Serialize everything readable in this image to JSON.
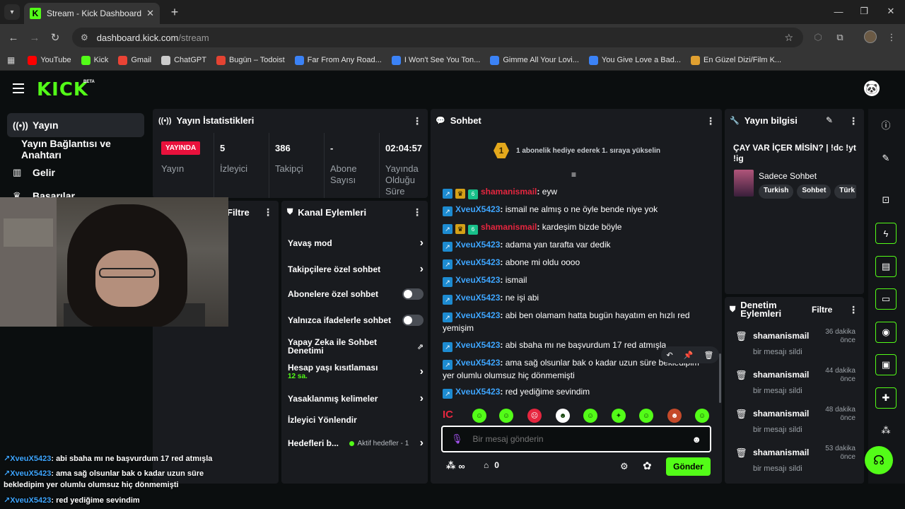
{
  "browser": {
    "tab_title": "Stream - Kick Dashboard",
    "url_host": "dashboard.kick.com",
    "url_path": "/stream",
    "bookmarks": [
      {
        "label": "YouTube",
        "color": "#ff0000"
      },
      {
        "label": "Kick",
        "color": "#53fc18"
      },
      {
        "label": "Gmail",
        "color": "#ea4335"
      },
      {
        "label": "ChatGPT",
        "color": "#cccccc"
      },
      {
        "label": "Bugün – Todoist",
        "color": "#e44332"
      },
      {
        "label": "Far From Any Road...",
        "color": "#3b82f6"
      },
      {
        "label": "I Won't See You Ton...",
        "color": "#3b82f6"
      },
      {
        "label": "Gimme All Your Lovi...",
        "color": "#3b82f6"
      },
      {
        "label": "You Give Love a Bad...",
        "color": "#3b82f6"
      },
      {
        "label": "En Güzel Dizi/Film K...",
        "color": "#e0a030"
      }
    ]
  },
  "kick": {
    "logo": "KICK",
    "beta": "BETA"
  },
  "sidebar": {
    "items": [
      {
        "label": "Yayın",
        "icon": "broadcast-icon"
      },
      {
        "label": "Yayın Bağlantısı ve Anahtarı",
        "icon": ""
      },
      {
        "label": "Gelir",
        "icon": "chart-icon"
      },
      {
        "label": "Başarılar",
        "icon": "trophy-icon"
      }
    ]
  },
  "stats": {
    "title": "Yayın İstatistikleri",
    "live_badge": "YAYINDA",
    "cells": [
      {
        "value": "",
        "label": "Yayın"
      },
      {
        "value": "5",
        "label": "İzleyici"
      },
      {
        "value": "386",
        "label": "Takipçi"
      },
      {
        "value": "-",
        "label": "Abone Sayısı"
      },
      {
        "value": "02:04:57",
        "label": "Yayında Olduğu Süre"
      }
    ]
  },
  "filter_panel": {
    "title": "Filtre"
  },
  "channel_actions": {
    "title": "Kanal Eylemleri",
    "items": [
      {
        "label": "Yavaş mod",
        "control": "chevron"
      },
      {
        "label": "Takipçilere özel sohbet",
        "control": "chevron"
      },
      {
        "label": "Abonelere özel sohbet",
        "control": "toggle"
      },
      {
        "label": "Yalnızca ifadelerle sohbet",
        "control": "toggle"
      },
      {
        "label": "Yapay Zeka ile Sohbet Denetimi",
        "control": "external"
      },
      {
        "label": "Hesap yaşı kısıtlaması",
        "sub": "12 sa.",
        "control": "chevron"
      },
      {
        "label": "Yasaklanmış kelimeler",
        "control": "chevron"
      },
      {
        "label": "İzleyici Yönlendir",
        "control": "none"
      },
      {
        "label": "Hedefleri b...",
        "sub": "Aktif hedefler - 1",
        "control": "chevron"
      }
    ]
  },
  "chat": {
    "title": "Sohbet",
    "pinned": "1 abonelik hediye ederek 1. sıraya yükselin",
    "rank": "1",
    "messages": [
      {
        "user": "shamanismail",
        "color": "red",
        "text": "eyw",
        "badges": [
          "blue",
          "gold",
          "green"
        ]
      },
      {
        "user": "XveuX5423",
        "color": "blue",
        "text": "ismail ne almış o ne öyle bende niye yok",
        "badges": [
          "blue"
        ]
      },
      {
        "user": "shamanismail",
        "color": "red",
        "text": "kardeşim bizde böyle",
        "badges": [
          "blue",
          "gold",
          "green"
        ]
      },
      {
        "user": "XveuX5423",
        "color": "blue",
        "text": "adama yan tarafta var dedik",
        "badges": [
          "blue"
        ]
      },
      {
        "user": "XveuX5423",
        "color": "blue",
        "text": "abone mi oldu oooo",
        "badges": [
          "blue"
        ]
      },
      {
        "user": "XveuX5423",
        "color": "blue",
        "text": "ismail",
        "badges": [
          "blue"
        ]
      },
      {
        "user": "XveuX5423",
        "color": "blue",
        "text": "ne işi abi",
        "badges": [
          "blue"
        ]
      },
      {
        "user": "XveuX5423",
        "color": "blue",
        "text": "abi ben olamam hatta bugün hayatım en hızlı red yemişim",
        "badges": [
          "blue"
        ]
      },
      {
        "user": "XveuX5423",
        "color": "blue",
        "text": "abi sbaha mı ne başvurdum 17 red atmışla",
        "badges": [
          "blue"
        ]
      },
      {
        "user": "XveuX5423",
        "color": "blue",
        "text": "ama sağ olsunlar bak o kadar uzun süre bekledipim yer olumlu olumsuz hiç dönmemişti",
        "badges": [
          "blue"
        ]
      },
      {
        "user": "XveuX5423",
        "color": "blue",
        "text": "red yediğime sevindim",
        "badges": [
          "blue"
        ]
      }
    ],
    "input_placeholder": "Bir mesaj gönderin",
    "points": "∞",
    "store_count": "0",
    "send_label": "Gönder"
  },
  "stream_info": {
    "title": "Yayın bilgisi",
    "stream_title": "ÇAY VAR İÇER MİSİN? | !dc !yt !ig",
    "category": "Sadece Sohbet",
    "tags": [
      "Turkish",
      "Sohbet",
      "Türk"
    ]
  },
  "moderation": {
    "title": "Denetim Eylemleri",
    "filter": "Filtre",
    "entries": [
      {
        "user": "shamanismail",
        "action": "bir mesajı sildi",
        "time": "36 dakika önce"
      },
      {
        "user": "shamanismail",
        "action": "bir mesajı sildi",
        "time": "44 dakika önce"
      },
      {
        "user": "shamanismail",
        "action": "bir mesajı sildi",
        "time": "48 dakika önce"
      },
      {
        "user": "shamanismail",
        "action": "bir mesajı sildi",
        "time": "53 dakika önce"
      }
    ]
  },
  "overlay_chat": [
    {
      "user": "XveuX5423",
      "text": "abi sbaha mı ne başvurdum 17 red atmışla"
    },
    {
      "user": "XveuX5423",
      "text": "ama sağ olsunlar bak o kadar uzun süre bekledipim yer olumlu olumsuz hiç dönmemişti"
    },
    {
      "user": "XveuX5423",
      "text": "red yediğime sevindim"
    }
  ],
  "colors": {
    "accent": "#53fc18",
    "live": "#e9113c",
    "panel": "#191b1f",
    "bg": "#0b0e0f"
  }
}
